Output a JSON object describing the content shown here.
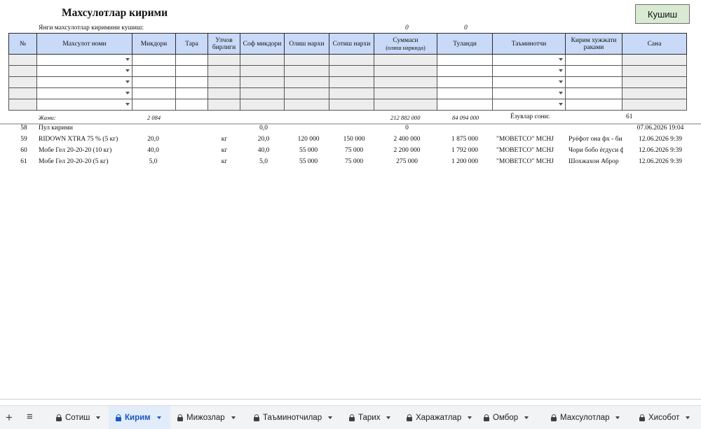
{
  "header": {
    "title": "Махсулотлар кирими",
    "subtitle": "Янги махсулотлар киримини кушиш:",
    "sub_values": [
      "0",
      "0"
    ],
    "add_button": "Кушиш"
  },
  "entry_table": {
    "columns": [
      "№",
      "Махсулот номи",
      "Микдори",
      "Тара",
      "Улчов бирлиги",
      "Соф микдори",
      "Олиш нархи",
      "Сотиш нархи",
      "Суммаси",
      "Туланди",
      "Таъминотчи",
      "Кирим хужжати раками",
      "Сана"
    ],
    "sum_subcaption": "(олиш наркида)",
    "empty_rows": 5
  },
  "totals": {
    "label": "Жами:",
    "quantity": "2 084",
    "sum": "212 882 000",
    "paid": "84 094 000",
    "rows_label": "Ёзувлар сони:",
    "rows_count": "61"
  },
  "records": [
    {
      "n": "58",
      "name": "Пул кирими",
      "qty": "",
      "unit": "",
      "net": "0,0",
      "buy": "",
      "sell": "",
      "sum": "0",
      "paid": "",
      "supplier": "",
      "doc": "",
      "date": "07.06.2026 19:04"
    },
    {
      "n": "59",
      "name": "RIDOWN XTRA 75 % (5 кг)",
      "qty": "20,0",
      "unit": "кг",
      "net": "20,0",
      "buy": "120 000",
      "sell": "150 000",
      "sum": "2 400 000",
      "paid": "1 875 000",
      "supplier": "\"MOBETCO\" MCHJ",
      "doc": "Руёфот она фх - би",
      "date": "12.06.2026 9:39"
    },
    {
      "n": "60",
      "name": "Мобе Гел 20-20-20 (10 кг)",
      "qty": "40,0",
      "unit": "кг",
      "net": "40,0",
      "buy": "55 000",
      "sell": "75 000",
      "sum": "2 200 000",
      "paid": "1 792 000",
      "supplier": "\"MOBETCO\" MCHJ",
      "doc": "Чори бобо ёгдуси ф",
      "date": "12.06.2026 9:39"
    },
    {
      "n": "61",
      "name": "Мобе Гел 20-20-20 (5 кг)",
      "qty": "5,0",
      "unit": "кг",
      "net": "5,0",
      "buy": "55 000",
      "sell": "75 000",
      "sum": "275 000",
      "paid": "1 200 000",
      "supplier": "\"MOBETCO\" MCHJ",
      "doc": "Шохжахон Аброр",
      "date": "12.06.2026 9:39"
    }
  ],
  "sheet_tabs": {
    "add_label": "+",
    "menu_label": "≡",
    "tabs": [
      {
        "label": "Сотиш",
        "active": false
      },
      {
        "label": "Кирим",
        "active": true
      },
      {
        "label": "Мижозлар",
        "active": false
      },
      {
        "label": "Таъминотчилар",
        "active": false
      },
      {
        "label": "Тарих",
        "active": false
      },
      {
        "label": "Харажатлар",
        "active": false
      },
      {
        "label": "Омбор",
        "active": false
      },
      {
        "label": "Махсулотлар",
        "active": false
      },
      {
        "label": "Хисобот",
        "active": false
      }
    ]
  },
  "colors": {
    "header_fill": "#c9daf8",
    "button_fill": "#d9ead3",
    "active_tab": "#1a57c6",
    "locked_cell": "#ededed"
  }
}
